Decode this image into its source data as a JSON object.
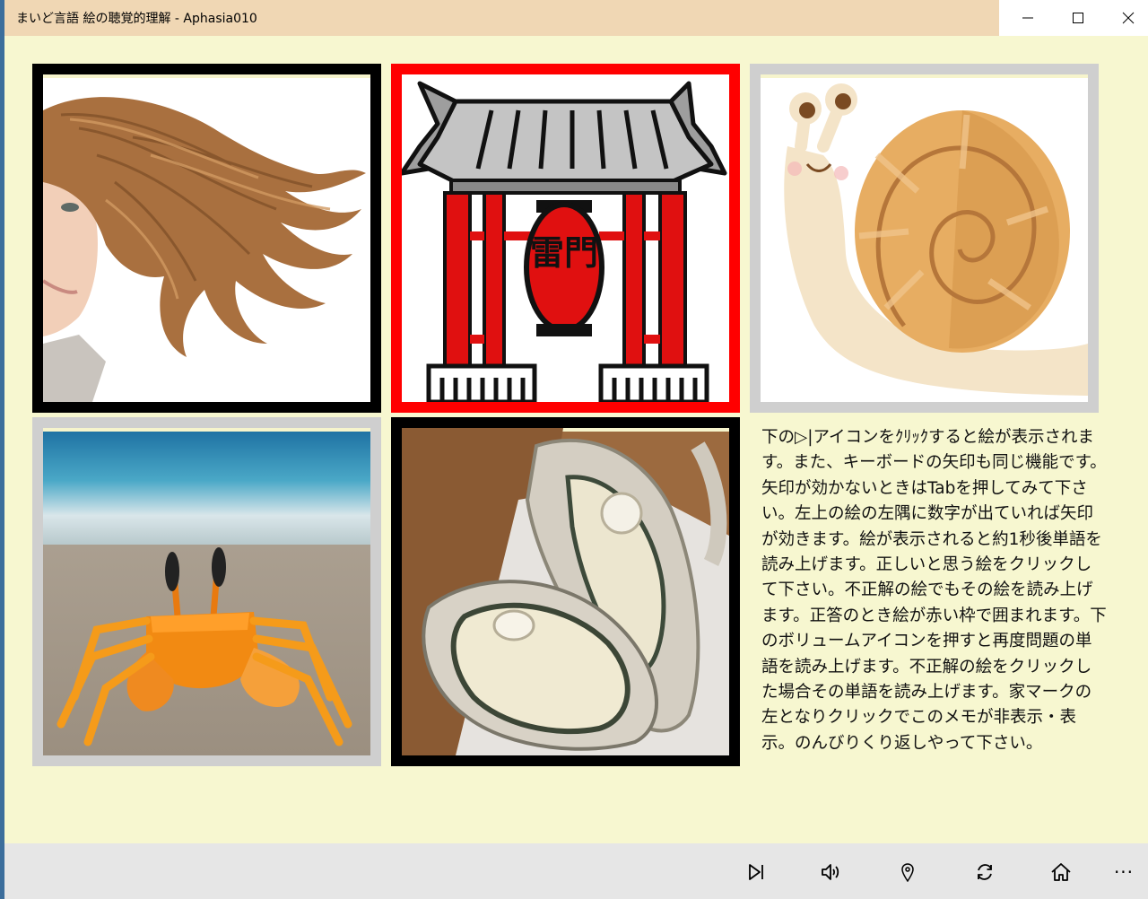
{
  "window": {
    "title": "まいど言語 絵の聴覚的理解 - Aphasia010",
    "title_bar_color": "#f0d7b4",
    "controls": [
      "minimize-icon",
      "maximize-icon",
      "close-icon"
    ]
  },
  "content": {
    "background": "#f7f7d0",
    "pictures": [
      {
        "name": "woman-hair",
        "frame": "black"
      },
      {
        "name": "kaminarimon-gate",
        "frame": "red",
        "selected": true
      },
      {
        "name": "snail",
        "frame": "gray"
      },
      {
        "name": "crab",
        "frame": "gray"
      },
      {
        "name": "oysters",
        "frame": "black"
      }
    ],
    "gate_lantern_text": "雷門",
    "memo": "下の▷|アイコンをｸﾘｯｸすると絵が表示されます。また、キーボードの矢印も同じ機能です。矢印が効かないときはTabを押してみて下さい。左上の絵の左隅に数字が出ていれば矢印が効きます。絵が表示されると約1秒後単語を読み上げます。正しいと思う絵をクリックして下さい。不正解の絵でもその絵を読み上げます。正答のとき絵が赤い枠で囲まれます。下のボリュームアイコンを押すと再度問題の単語を読み上げます。不正解の絵をクリックした場合その単語を読み上げます。家マークの左となりクリックでこのメモが非表示・表示。のんびりくり返しやって下さい。"
  },
  "appbar": {
    "buttons": [
      "next-track-icon",
      "volume-icon",
      "location-pin-icon",
      "refresh-icon",
      "home-icon",
      "more-icon"
    ],
    "more_label": "···"
  }
}
